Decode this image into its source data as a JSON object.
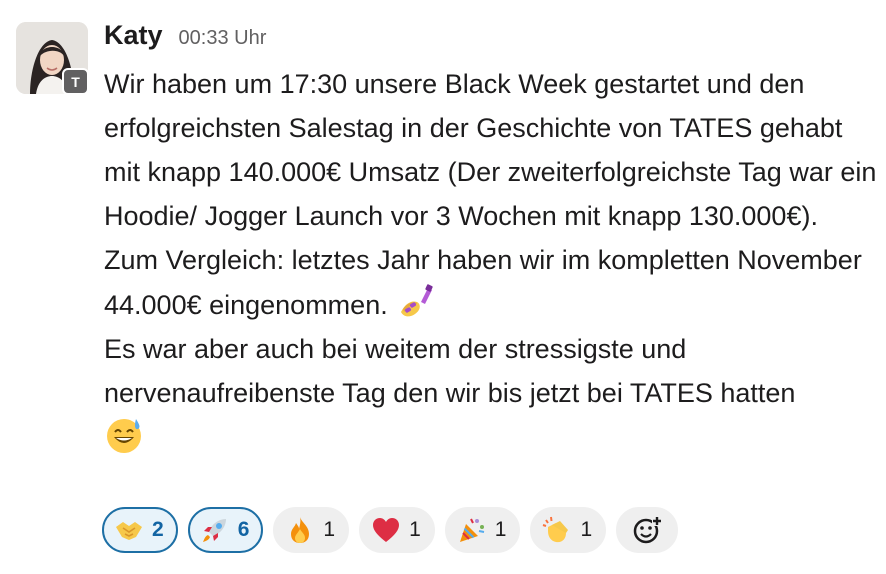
{
  "message": {
    "author": "Katy",
    "timestamp": "00:33 Uhr",
    "org_badge": "T",
    "paragraph1": "Wir haben um 17:30 unsere Black Week gestartet und den erfolgreichsten Salestag in der Geschichte von TATES gehabt mit knapp 140.000€ Umsatz (Der zweiterfolgreichste Tag war ein Hoodie/ Jogger Launch vor 3 Wochen mit knapp 130.000€). Zum Vergleich: letztes Jahr haben wir im kompletten November 44.000€ eingenommen.",
    "paragraph1_emoji": "nail-polish-icon",
    "paragraph2": "Es war aber auch bei weitem der stressigste und nervenaufreibenste Tag den wir bis jetzt bei TATES hatten",
    "paragraph2_emoji": "sweat-smile-icon"
  },
  "reactions": [
    {
      "icon": "handshake-icon",
      "count": "2",
      "active": true
    },
    {
      "icon": "rocket-icon",
      "count": "6",
      "active": true
    },
    {
      "icon": "fire-icon",
      "count": "1",
      "active": false
    },
    {
      "icon": "heart-icon",
      "count": "1",
      "active": false
    },
    {
      "icon": "party-popper-icon",
      "count": "1",
      "active": false
    },
    {
      "icon": "clapping-hands-icon",
      "count": "1",
      "active": false
    }
  ],
  "add_reaction_icon": "add-reaction-icon",
  "colors": {
    "active_border": "#1d6fa5",
    "active_bg": "#e8f3fa",
    "active_count": "#1264a3",
    "pill_bg": "#efefef",
    "timestamp": "#616061"
  }
}
